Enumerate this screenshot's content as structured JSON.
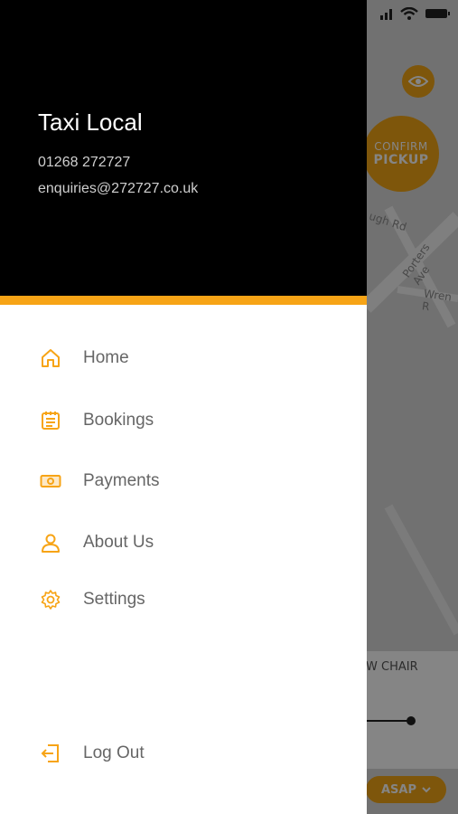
{
  "company": {
    "name": "Taxi Local",
    "phone": "01268 272727",
    "email": "enquiries@272727.co.uk"
  },
  "menu": [
    {
      "label": "Home",
      "icon": "home-icon"
    },
    {
      "label": "Bookings",
      "icon": "bookings-icon"
    },
    {
      "label": "Payments",
      "icon": "payments-icon"
    },
    {
      "label": "About Us",
      "icon": "user-icon"
    },
    {
      "label": "Settings",
      "icon": "gear-icon"
    }
  ],
  "logout": {
    "label": "Log Out",
    "icon": "logout-icon"
  },
  "background": {
    "confirm_line1": "CONFIRM",
    "confirm_line2": "PICKUP",
    "road_labels": [
      "ugh Rd",
      "Porters Ave",
      "Wren R"
    ],
    "chair_label": "W CHAIR",
    "asap_label": "ASAP"
  },
  "colors": {
    "accent": "#f7a416",
    "header_bg": "#000000",
    "label": "#666666"
  }
}
